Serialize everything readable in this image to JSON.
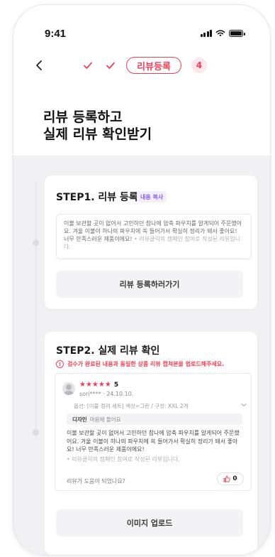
{
  "status_bar": {
    "time": "9:41"
  },
  "progress": {
    "current_step": "리뷰등록",
    "next_step": "4"
  },
  "page_title": {
    "line1": "리뷰 등록하고",
    "line2": "실제 리뷰 확인받기"
  },
  "step1": {
    "title": "STEP1. 리뷰 등록",
    "copy_badge": "내용 복사",
    "review_text": "이불 보관할 곳이 없어서 고민하던 참나에 압축 파우치를 알게되어 주문했어요. 겨울 이불이 하나의 파우치에 쏙 들어가서 확실히 정리가 돼서 좋아요! 너무 만족스러운 제품이에요!",
    "disclaimer": "• 리뷰클릭의 캠페인 참여로 작성된 리뷰입니다.",
    "button_label": "리뷰 등록하러가기"
  },
  "step2": {
    "title": "STEP2. 실제 리뷰 확인",
    "warning": "검수가 완료된 내용과 동일한 상품 리뷰 캡쳐본을 업로드해주세요.",
    "review": {
      "stars": "★★★★★",
      "rating": "5",
      "reviewer": "sori****  ·  24.10.10.",
      "option": "옵션: [이불 정리 세트] 색상=그린 / 구성: XXL 2개",
      "design_label": "디자인",
      "design_value": "마음에 들어요",
      "text": "이불 보관할 곳이 없어서 고민하던 참나에 압축 파우치를 알게되어 주문했어요. 겨울 이불이 하나의 파우치에 쏙 들어가서 확실히 정리가 돼서 좋아요! 너무 만족스러운 제품이에요!",
      "disclaimer": "• 리뷰클릭의 캠페인 참여로 작성된 리뷰입니다.",
      "helpful_prompt": "리뷰가 도움이 되었나요?",
      "likes": "0"
    },
    "button_label": "이미지 업로드"
  },
  "colors": {
    "accent": "#ee3f58",
    "badge": "#8a5cf5",
    "background": "#f1f1f3"
  },
  "icons": [
    "back-chevron-icon",
    "check-icon",
    "warning-icon",
    "thumbs-up-icon",
    "chevron-down-icon"
  ]
}
